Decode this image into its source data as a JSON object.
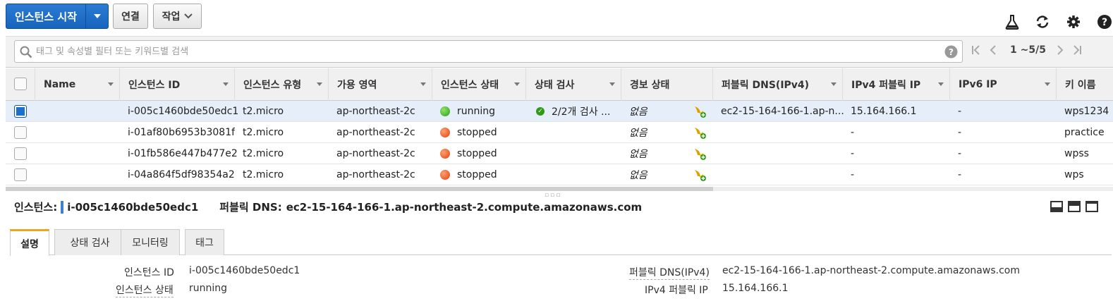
{
  "toolbar": {
    "launch_label": "인스턴스 시작",
    "connect_label": "연결",
    "actions_label": "작업"
  },
  "search": {
    "placeholder": "태그 및 속성별 필터 또는 키워드별 검색"
  },
  "pagination": {
    "text": "1 ~5/5"
  },
  "table": {
    "columns": [
      "Name",
      "인스턴스 ID",
      "인스턴스 유형",
      "가용 영역",
      "인스턴스 상태",
      "상태 검사",
      "경보 상태",
      "퍼블릭 DNS(IPv4)",
      "IPv4 퍼블릭 IP",
      "IPv6 IP",
      "키 이름"
    ],
    "rows": [
      {
        "name": "",
        "id": "i-005c1460bde50edc1",
        "type": "t2.micro",
        "az": "ap-northeast-2c",
        "state": "running",
        "check": "2/2개 검사 ...",
        "alarm": "없음",
        "dns": "ec2-15-164-166-1.ap-n...",
        "ip": "15.164.166.1",
        "ipv6": "-",
        "key": "wps1234",
        "selected": true
      },
      {
        "name": "",
        "id": "i-01af80b6953b3081f",
        "type": "t2.micro",
        "az": "ap-northeast-2c",
        "state": "stopped",
        "check": "",
        "alarm": "없음",
        "dns": "",
        "ip": "-",
        "ipv6": "-",
        "key": "practice",
        "selected": false
      },
      {
        "name": "",
        "id": "i-01fb586e447b477e2",
        "type": "t2.micro",
        "az": "ap-northeast-2c",
        "state": "stopped",
        "check": "",
        "alarm": "없음",
        "dns": "",
        "ip": "-",
        "ipv6": "-",
        "key": "wpss",
        "selected": false
      },
      {
        "name": "",
        "id": "i-04a864f5df98354a2",
        "type": "t2.micro",
        "az": "ap-northeast-2c",
        "state": "stopped",
        "check": "",
        "alarm": "없음",
        "dns": "",
        "ip": "-",
        "ipv6": "-",
        "key": "wps",
        "selected": false
      }
    ]
  },
  "detail": {
    "instance_label": "인스턴스:",
    "instance_id": "i-005c1460bde50edc1",
    "dns_label": "퍼블릭 DNS:",
    "dns_value": "ec2-15-164-166-1.ap-northeast-2.compute.amazonaws.com",
    "tabs": [
      "설명",
      "상태 검사",
      "모니터링",
      "태그"
    ],
    "fields": {
      "id_label": "인스턴스 ID",
      "id_value": "i-005c1460bde50edc1",
      "state_label": "인스턴스 상태",
      "state_value": "running",
      "dns_label": "퍼블릭 DNS(IPv4)",
      "dns_value": "ec2-15-164-166-1.ap-northeast-2.compute.amazonaws.com",
      "ip_label": "IPv4 퍼블릭 IP",
      "ip_value": "15.164.166.1"
    }
  },
  "colors": {
    "primary": "#1a6fd0",
    "running": "#2f9b17",
    "stopped": "#e2400f",
    "tab_accent": "#f0a522"
  }
}
